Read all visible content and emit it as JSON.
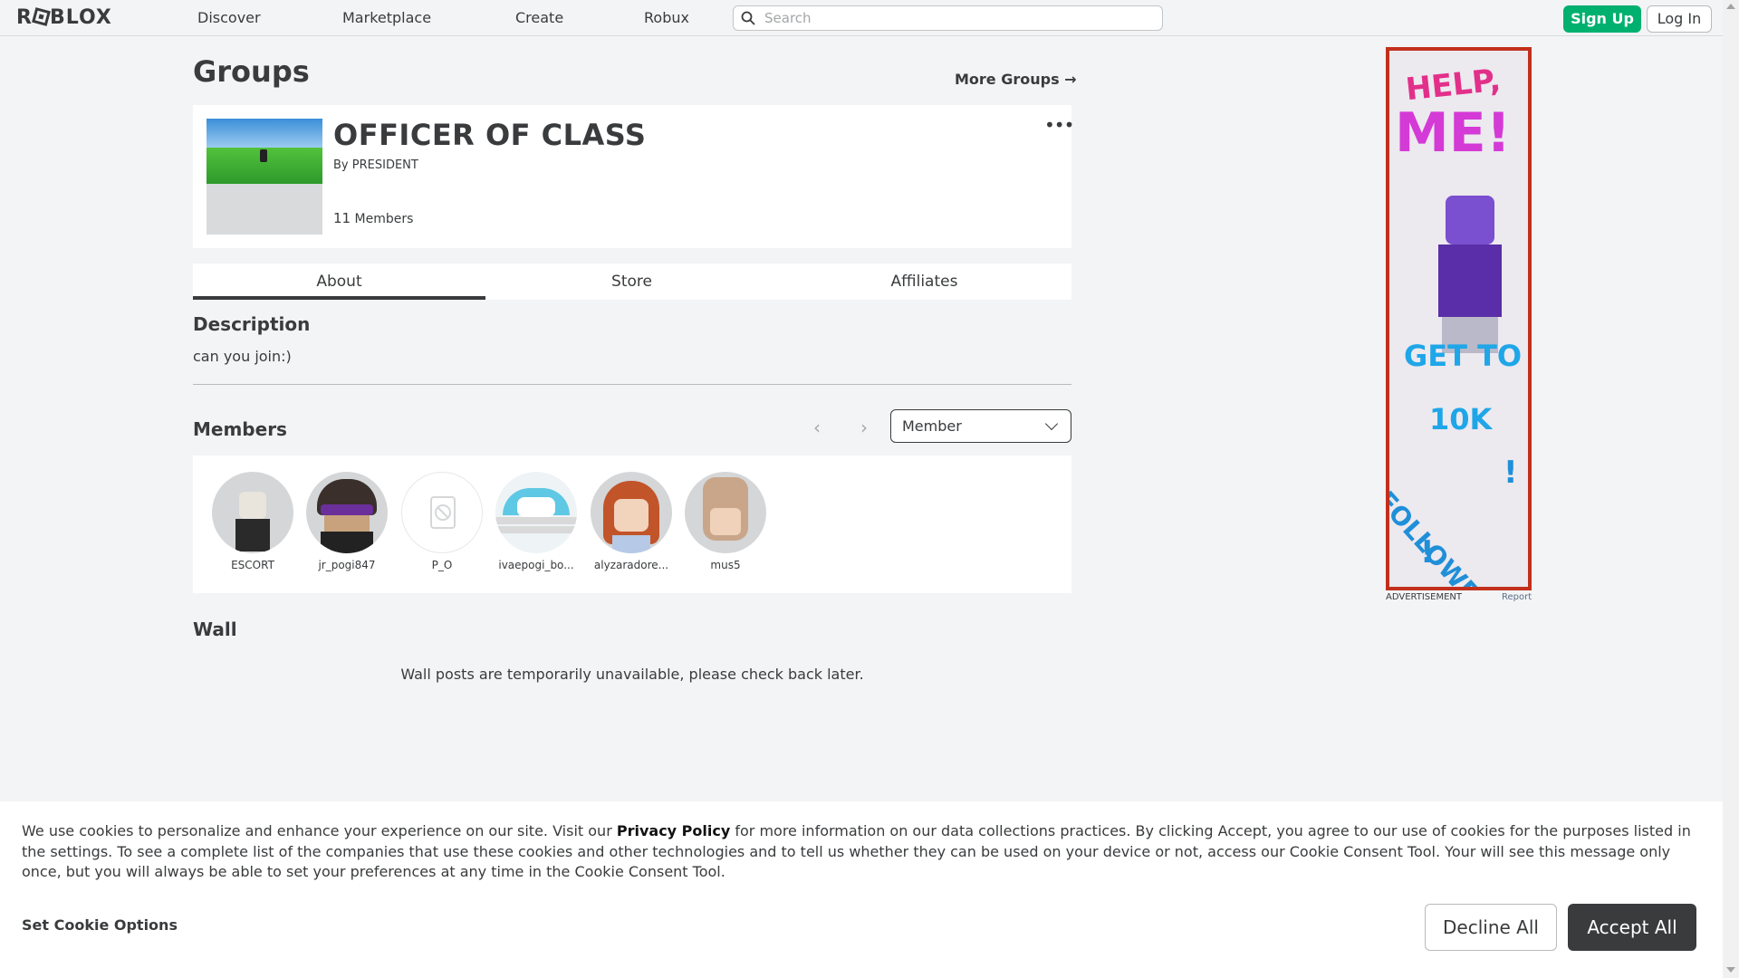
{
  "nav": {
    "logo": "ROBLOX",
    "links": [
      "Discover",
      "Marketplace",
      "Create",
      "Robux"
    ],
    "search_placeholder": "Search",
    "signup": "Sign Up",
    "login": "Log In"
  },
  "page": {
    "title": "Groups",
    "more_groups": "More Groups →"
  },
  "group": {
    "name": "OFFICER OF CLASS",
    "by_prefix": "By",
    "owner": "PRESIDENT",
    "member_count": "11",
    "member_label": "Members",
    "menu": "•••"
  },
  "tabs": [
    "About",
    "Store",
    "Affiliates"
  ],
  "description": {
    "heading": "Description",
    "text": "can you join:)"
  },
  "members": {
    "heading": "Members",
    "prev": "‹",
    "next": "›",
    "role_selected": "Member",
    "list": [
      {
        "name": "ESCORT",
        "color": "#8a8d90"
      },
      {
        "name": "jr_pogi847",
        "color": "#3a2f2a"
      },
      {
        "name": "P_O",
        "color": "#ffffff"
      },
      {
        "name": "ivaepogi_bo...",
        "color": "#6fd0e6"
      },
      {
        "name": "alyzaradore...",
        "color": "#d06a3a"
      },
      {
        "name": "mus5",
        "color": "#c9a68a"
      }
    ]
  },
  "wall": {
    "heading": "Wall",
    "message": "Wall posts are temporarily unavailable, please check back later."
  },
  "ad": {
    "help": "HELP,",
    "me": "ME!",
    "getto": "GET TO",
    "tenk": "10K",
    "followers": "FOLLOWERS",
    "excl": "!",
    "label": "ADVERTISEMENT",
    "report": "Report"
  },
  "cookie": {
    "text_before": "We use cookies to personalize and enhance your experience on our site. Visit our ",
    "policy_link": "Privacy Policy",
    "text_after": " for more information on our data collections practices. By clicking Accept, you agree to our use of cookies for the purposes listed in the settings. To see a complete list of the companies that use these cookies and other technologies and to tell us whether they can be used on your device or not, access our Cookie Consent Tool. Your will see this message only once, but you will always be able to set your preferences at any time in the Cookie Consent Tool.",
    "set_options": "Set Cookie Options",
    "decline": "Decline All",
    "accept": "Accept All"
  },
  "colors": {
    "accent_green": "#00b06f",
    "text": "#393b3d",
    "background": "#f2f4f5"
  }
}
